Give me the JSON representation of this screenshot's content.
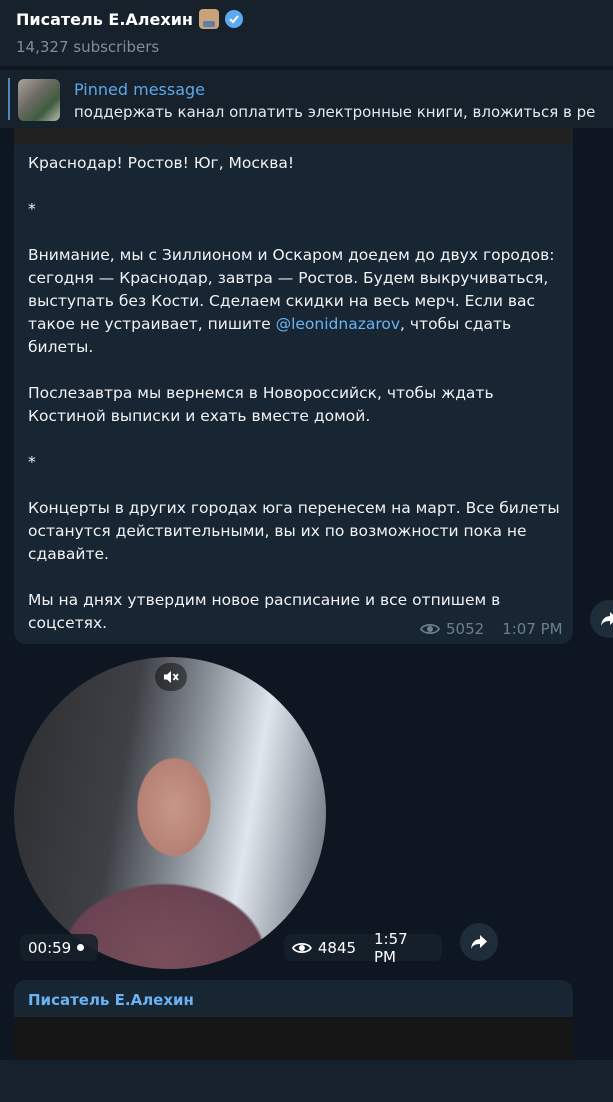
{
  "header": {
    "channel_name": "Писатель Е.Алехин",
    "subscribers": "14,327 subscribers"
  },
  "pinned": {
    "label": "Pinned message",
    "text": "поддержать канал оплатить электронные книги, вложиться в ре"
  },
  "post1": {
    "text_lines": {
      "p1": "Краснодар! Ростов! Юг, Москва!",
      "star1": "*",
      "p2_before": "Внимание, мы с Зиллионом и Оскаром доедем до двух городов: сегодня — Краснодар, завтра — Ростов. Будем выкручиваться, выступать без Кости. Сделаем скидки на весь мерч. Если вас такое не устраивает, пишите ",
      "mention": "@leonidnazarov",
      "p2_after": ", чтобы сдать билеты.",
      "p3": "Послезавтра мы вернемся в Новороссийск, чтобы ждать Костиной выписки и ехать вместе домой.",
      "star2": "*",
      "p4": "Концерты в других городах юга перенесем на март. Все билеты останутся действительными, вы их по возможности пока не сдавайте.",
      "p5": "Мы на днях утвердим новое расписание и все отпишем в соцсетях."
    },
    "views": "5052",
    "time": "1:07 PM"
  },
  "post2": {
    "duration": "00:59",
    "views": "4845",
    "time": "1:57 PM"
  },
  "post3": {
    "author": "Писатель Е.Алехин"
  },
  "colors": {
    "background": "#0e1621",
    "bubble": "#182533",
    "link": "#6ab3f3",
    "verified": "#5eaaf1"
  }
}
